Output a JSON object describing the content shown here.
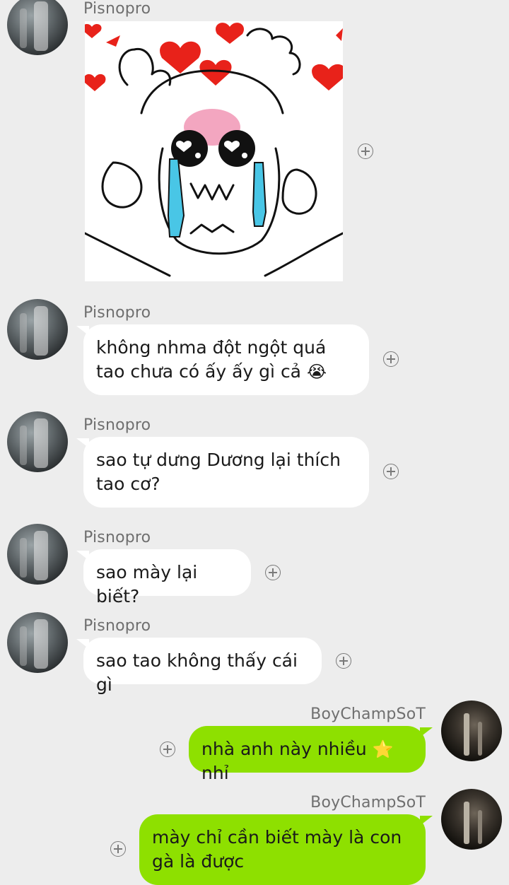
{
  "contact_name": "Pisnopro",
  "self_name": "BoyChampSoT",
  "sticker": {
    "icon": "crying-cat-hearts-sticker"
  },
  "messages": [
    {
      "text": "không nhma đột ngột quá tao chưa có ấy ấy gì cả",
      "emoji": "😭"
    },
    {
      "text": "sao tự dưng Dương lại thích tao cơ?"
    },
    {
      "text": "sao mày lại biết?"
    },
    {
      "text": "sao tao không thấy cái gì"
    }
  ],
  "outgoing": [
    {
      "text_before": "nhà anh này nhiều",
      "emoji": "⭐",
      "text_after": "nhỉ"
    },
    {
      "text": "mày chỉ cần biết mày là con gà là được"
    }
  ],
  "colors": {
    "background": "#ededed",
    "incoming_bubble": "#ffffff",
    "outgoing_bubble": "#8ee000"
  }
}
